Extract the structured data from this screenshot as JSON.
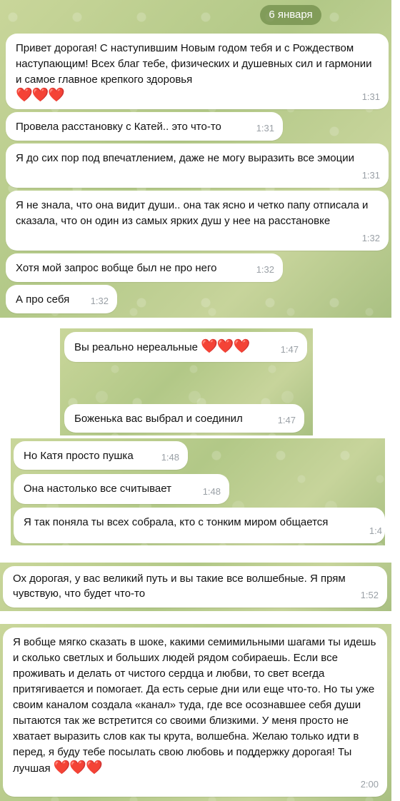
{
  "date_chip": "6 января",
  "screens": [
    {
      "messages": [
        {
          "text": "Привет дорогая! С наступившим Новым годом тебя и с Рождеством наступающим! Всех благ тебе, физических и душевных сил и гармонии и самое главное крепкого здоровья",
          "hearts": "❤️❤️❤️",
          "time": "1:31"
        },
        {
          "text": "Провела расстановку с Катей.. это что-то",
          "time": "1:31"
        },
        {
          "text": "Я до сих пор под впечатлением, даже не могу выразить все эмоции",
          "time": "1:31"
        },
        {
          "text": "Я не знала, что она видит души.. она так ясно и четко папу отписала и сказала, что он один из самых ярких душ у нее на расстановке",
          "time": "1:32"
        },
        {
          "text": "Хотя мой запрос вобще был не про него",
          "time": "1:32"
        },
        {
          "text": "А про себя",
          "time": "1:32"
        }
      ]
    },
    {
      "messages": [
        {
          "text": "Вы реально нереальные",
          "hearts": "❤️❤️❤️",
          "time": "1:47"
        },
        {
          "text": "Боженька вас выбрал и соединил",
          "time": "1:47"
        }
      ]
    },
    {
      "messages": [
        {
          "text": "Но Катя просто пушка",
          "time": "1:48"
        },
        {
          "text": "Она настолько все считывает",
          "time": "1:48"
        },
        {
          "text": "Я так поняла ты всех собрала, кто с тонким миром общается",
          "time": "1:4"
        }
      ]
    },
    {
      "messages": [
        {
          "text": "Ох дорогая, у вас великий путь и вы такие все волшебные. Я прям чувствую, что будет что-то",
          "time": "1:52"
        }
      ]
    },
    {
      "messages": [
        {
          "text": "Я вобще мягко сказать в шоке, какими семимильными шагами ты идешь и сколько светлых и больших людей рядом собираешь. Если все проживать и делать от чистого сердца и любви, то свет всегда притягивается и помогает. Да есть серые дни или еще что-то. Но ты уже своим каналом создала «канал» туда, где все осознавшее себя души пытаются так же встретится со своими близкими. У меня просто не хватает выразить слов как ты крута, волшебна. Желаю только идти в перед, я буду тебе посылать свою любовь и поддержку дорогая! Ты лучшая",
          "hearts": "❤️❤️❤️",
          "time": "2:00"
        }
      ]
    }
  ]
}
